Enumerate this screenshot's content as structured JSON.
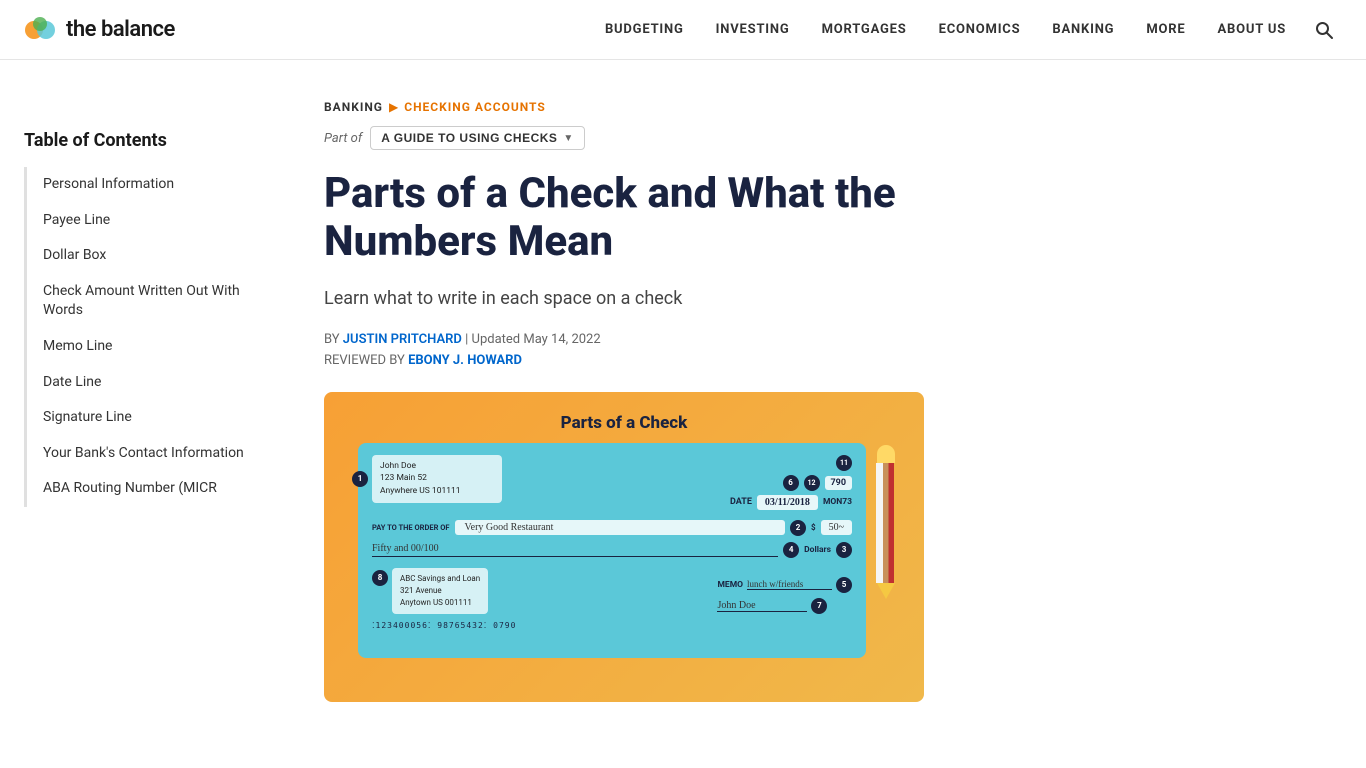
{
  "site": {
    "name": "the balance",
    "logo_alt": "The Balance logo"
  },
  "nav": {
    "items": [
      {
        "label": "BUDGETING",
        "id": "nav-budgeting"
      },
      {
        "label": "INVESTING",
        "id": "nav-investing"
      },
      {
        "label": "MORTGAGES",
        "id": "nav-mortgages"
      },
      {
        "label": "ECONOMICS",
        "id": "nav-economics"
      },
      {
        "label": "BANKING",
        "id": "nav-banking"
      },
      {
        "label": "MORE",
        "id": "nav-more"
      },
      {
        "label": "ABOUT US",
        "id": "nav-about"
      }
    ]
  },
  "breadcrumb": {
    "section": "BANKING",
    "subsection": "CHECKING ACCOUNTS"
  },
  "part_of": {
    "label": "Part of",
    "guide": "A GUIDE TO USING CHECKS"
  },
  "article": {
    "title": "Parts of a Check and What the Numbers Mean",
    "subtitle": "Learn what to write in each space on a check",
    "author": "JUSTIN PRITCHARD",
    "updated": "Updated May 14, 2022",
    "reviewed_by_label": "REVIEWED BY",
    "reviewer": "EBONY J. HOWARD"
  },
  "toc": {
    "title": "Table of Contents",
    "items": [
      {
        "label": "Personal Information"
      },
      {
        "label": "Payee Line"
      },
      {
        "label": "Dollar Box"
      },
      {
        "label": "Check Amount Written Out With Words"
      },
      {
        "label": "Memo Line"
      },
      {
        "label": "Date Line"
      },
      {
        "label": "Signature Line"
      },
      {
        "label": "Your Bank's Contact Information"
      },
      {
        "label": "ABA Routing Number (MICR"
      }
    ]
  },
  "check_image": {
    "title": "Parts of a Check",
    "address_name": "John Doe",
    "address_street": "123 Main 52",
    "address_city": "Anywhere US 101111",
    "date_label": "DATE",
    "date_value": "03/11/2018",
    "check_number": "790",
    "check_subnumber": "MON73",
    "payto_label": "PAY TO THE ORDER OF",
    "payto_value": "Very Good Restaurant",
    "dollar_symbol": "$",
    "dollar_amount": "50~",
    "words_value": "Fifty and 00/100",
    "dollars_label": "Dollars",
    "bank_name": "ABC Savings and Loan",
    "bank_street": "321 Avenue",
    "bank_city": "Anytown US 001111",
    "memo_label": "MEMO",
    "memo_value": "lunch w/friends",
    "signature_value": "John Doe",
    "routing_number": "⁚123400056⁚  98765432⁚  0790"
  },
  "colors": {
    "accent_orange": "#e67300",
    "nav_text": "#333333",
    "title_color": "#1a2340",
    "link_color": "#0066cc",
    "check_bg": "#5bc8d8",
    "image_bg": "#f7a035"
  }
}
